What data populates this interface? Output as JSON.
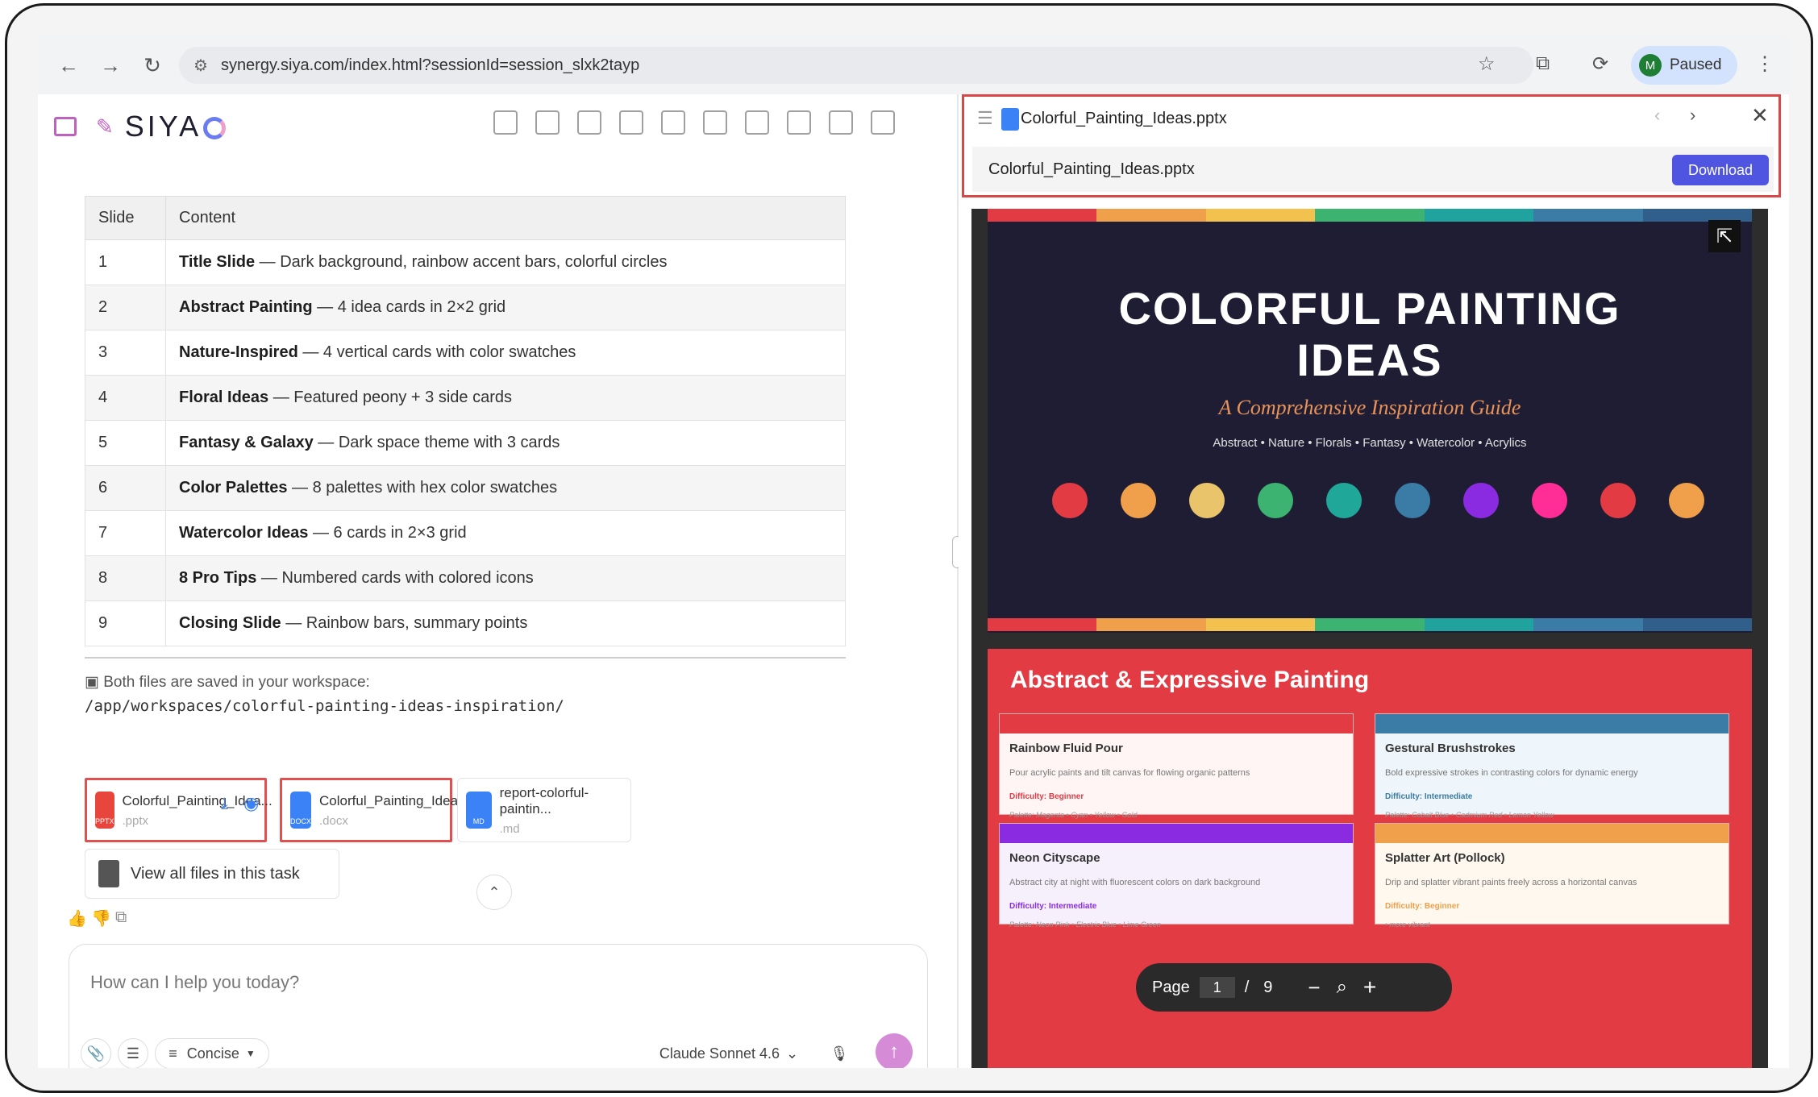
{
  "browser": {
    "url": "synergy.siya.com/index.html?sessionId=session_slxk2tayp",
    "profile_initial": "M",
    "profile_status": "Paused"
  },
  "app": {
    "logo": "SIYA"
  },
  "table": {
    "headers": [
      "Slide",
      "Content"
    ],
    "rows": [
      {
        "num": "1",
        "title": "Title Slide",
        "desc": " — Dark background, rainbow accent bars, colorful circles"
      },
      {
        "num": "2",
        "title": "Abstract Painting",
        "desc": " — 4 idea cards in 2×2 grid"
      },
      {
        "num": "3",
        "title": "Nature-Inspired",
        "desc": " — 4 vertical cards with color swatches"
      },
      {
        "num": "4",
        "title": "Floral Ideas",
        "desc": " — Featured peony + 3 side cards"
      },
      {
        "num": "5",
        "title": "Fantasy & Galaxy",
        "desc": " — Dark space theme with 3 cards"
      },
      {
        "num": "6",
        "title": "Color Palettes",
        "desc": " — 8 palettes with hex color swatches"
      },
      {
        "num": "7",
        "title": "Watercolor Ideas",
        "desc": " — 6 cards in 2×3 grid"
      },
      {
        "num": "8",
        "title": "8 Pro Tips",
        "desc": " — Numbered cards with colored icons"
      },
      {
        "num": "9",
        "title": "Closing Slide",
        "desc": " — Rainbow bars, summary points"
      }
    ]
  },
  "workspace": {
    "saved_text": "Both files are saved in your workspace:",
    "path": "/app/workspaces/colorful-painting-ideas-inspiration/"
  },
  "files": [
    {
      "name": "Colorful_Painting_Idea...",
      "ext": ".pptx",
      "badge": "PPTX",
      "color": "#e8453c"
    },
    {
      "name": "Colorful_Painting_Idea...",
      "ext": ".docx",
      "badge": "DOCX",
      "color": "#3b82f6"
    },
    {
      "name": "report-colorful-paintin...",
      "ext": ".md",
      "badge": "MD",
      "color": "#3b82f6"
    }
  ],
  "view_all": "View all files in this task",
  "input": {
    "placeholder": "How can I help you today?",
    "mode": "Concise",
    "model": "Claude Sonnet 4.6"
  },
  "preview": {
    "filename": "Colorful_Painting_Ideas.pptx",
    "download": "Download",
    "page_label": "Page",
    "current_page": "1",
    "separator": "/",
    "total_pages": "9"
  },
  "slide1": {
    "title_line1": "COLORFUL PAINTING",
    "title_line2": "IDEAS",
    "subtitle": "A Comprehensive Inspiration Guide",
    "tags": "Abstract • Nature • Florals • Fantasy • Watercolor • Acrylics",
    "rainbow": [
      "#e23b43",
      "#f0a04b",
      "#f2c14e",
      "#3cb371",
      "#20a39e",
      "#3a7ca5",
      "#2f5f8a"
    ],
    "dots": [
      "#e23b43",
      "#f0a04b",
      "#e9c46a",
      "#3cb371",
      "#1fa89a",
      "#3a7ca5",
      "#8a2be2",
      "#ff2d95",
      "#e23b43",
      "#f0a04b"
    ]
  },
  "slide2": {
    "title": "Abstract & Expressive Painting",
    "cards": [
      {
        "title": "Rainbow Fluid Pour",
        "desc": "Pour acrylic paints and tilt canvas for flowing organic patterns",
        "difficulty": "Difficulty: Beginner",
        "palette": "Palette: Magenta • Cyan • Yellow • Gold",
        "bar": "#e23b43",
        "bg": "#fff5f5",
        "dcol": "#e23b43"
      },
      {
        "title": "Gestural Brushstrokes",
        "desc": "Bold expressive strokes in contrasting colors for dynamic energy",
        "difficulty": "Difficulty: Intermediate",
        "palette": "Palette: Cobalt Blue • Cadmium Red • Lemon Yellow",
        "bar": "#3a7ca5",
        "bg": "#eef5fb",
        "dcol": "#3a7ca5"
      },
      {
        "title": "Neon Cityscape",
        "desc": "Abstract city at night with fluorescent colors on dark background",
        "difficulty": "Difficulty: Intermediate",
        "palette": "Palette: Neon Pink • Electric Blue • Lime Green",
        "bar": "#8a2be2",
        "bg": "#f6f0fd",
        "dcol": "#8a2be2"
      },
      {
        "title": "Splatter Art (Pollock)",
        "desc": "Drip and splatter vibrant paints freely across a horizontal canvas",
        "difficulty": "Difficulty: Beginner",
        "palette": "• more vibrant",
        "bar": "#f0a04b",
        "bg": "#fff8ee",
        "dcol": "#f0a04b"
      }
    ]
  }
}
